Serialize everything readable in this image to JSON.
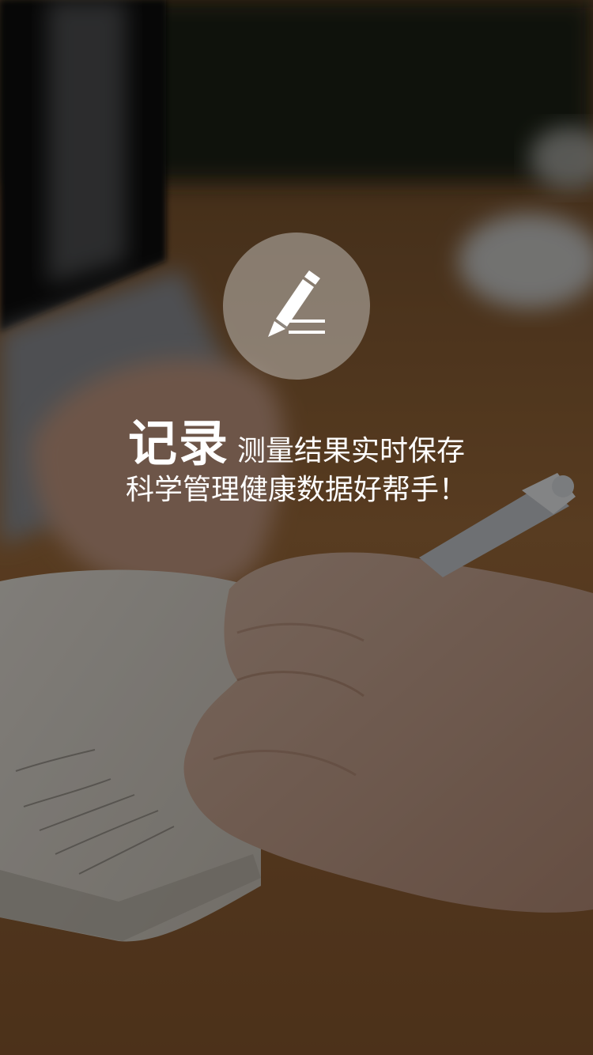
{
  "feature": {
    "title": "记录",
    "tagline": "测量结果实时保存",
    "subtitle": "科学管理健康数据好帮手！",
    "icon": "pencil-write-icon"
  },
  "colors": {
    "text": "#ffffff",
    "icon_circle": "#8f8a85",
    "overlay": "#000000"
  }
}
